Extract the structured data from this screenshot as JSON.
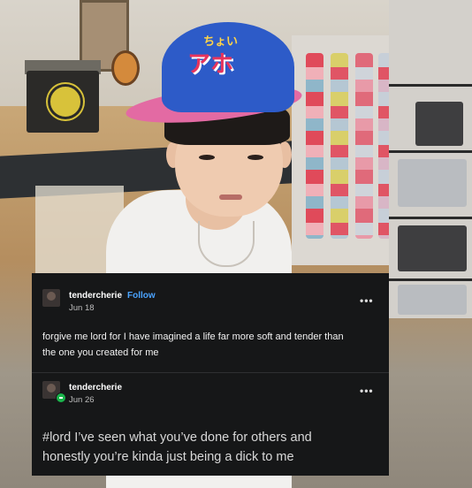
{
  "posts": [
    {
      "username": "tendercherie",
      "follow_label": "Follow",
      "date": "Jun 18",
      "text_line1": "forgive me lord for I have imagined a life far more soft and tender than",
      "text_line2": "the one you created for me"
    },
    {
      "username": "tendercherie",
      "date": "Jun 26",
      "text_line1": "#lord I’ve seen what you’ve done for others and",
      "text_line2": "honestly you’re kinda just being a dick to me"
    }
  ],
  "more_label": "•••",
  "photo": {
    "cap_text": "アホ",
    "cap_small": "ちょい"
  },
  "colors": {
    "card_bg": "#161718",
    "follow_blue": "#4aa3ff",
    "status_green": "#19b34a"
  }
}
